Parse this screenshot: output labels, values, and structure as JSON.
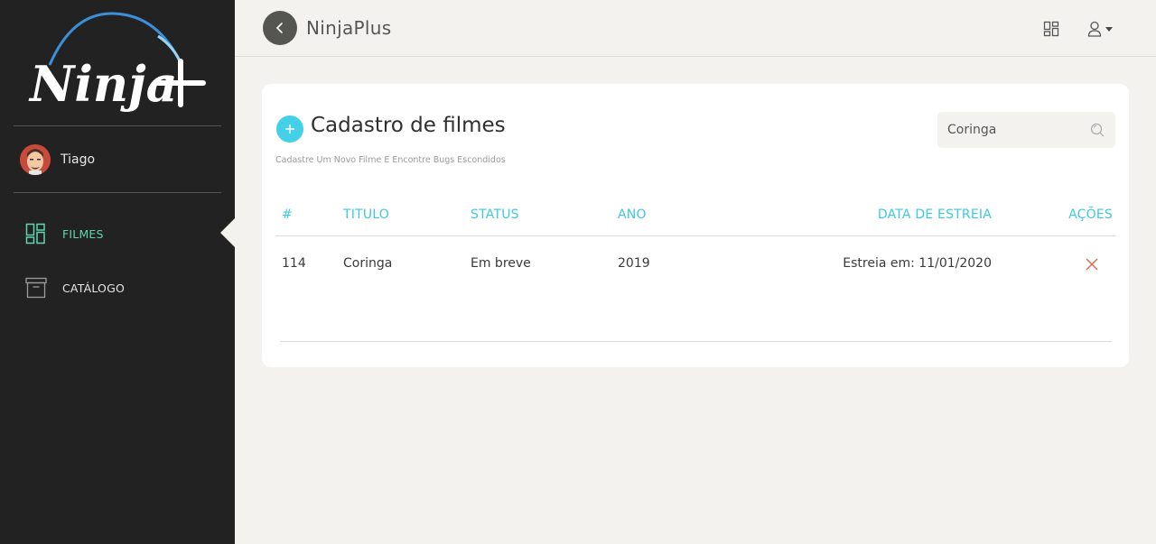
{
  "app": {
    "title": "NinjaPlus",
    "logo_text": "Ninja+"
  },
  "sidebar": {
    "user_name": "Tiago",
    "items": [
      {
        "label": "FILMES",
        "icon": "dashboard-icon",
        "active": true
      },
      {
        "label": "CATÁLOGO",
        "icon": "archive-icon",
        "active": false
      }
    ]
  },
  "header": {
    "icons": [
      "back-arrow-icon",
      "grid-icon",
      "user-icon"
    ]
  },
  "card": {
    "title": "Cadastro de filmes",
    "subtitle": "Cadastre Um Novo Filme E Encontre Bugs Escondidos",
    "search": {
      "value": "Coringa"
    }
  },
  "table": {
    "headers": [
      "#",
      "TITULO",
      "STATUS",
      "ANO",
      "DATA DE ESTREIA",
      "AÇÕES"
    ],
    "rows": [
      {
        "id": "114",
        "title": "Coringa",
        "status": "Em breve",
        "year": "2019",
        "release": "Estreia em: 11/01/2020"
      }
    ]
  },
  "colors": {
    "sidebar_bg": "#222222",
    "accent_cyan": "#45d0e8",
    "active_green": "#5fd6b0",
    "delete_red": "#e8604c",
    "page_bg": "#f3f2ef"
  }
}
